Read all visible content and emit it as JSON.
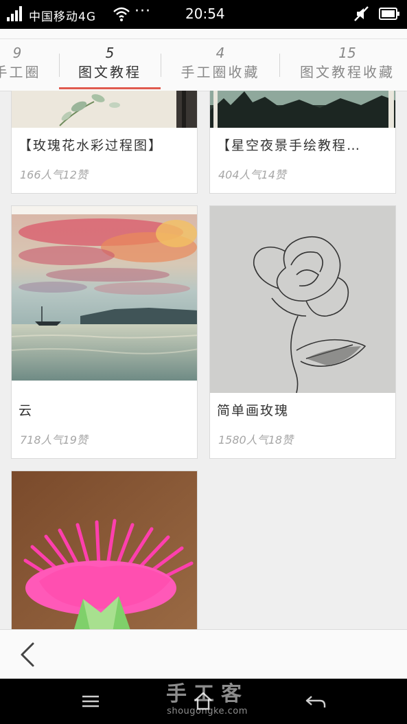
{
  "status_bar": {
    "carrier": "中国移动4G",
    "dots": "···",
    "time": "20:54",
    "icons": [
      "signal-icon",
      "wifi-icon",
      "mute-icon",
      "battery-icon"
    ]
  },
  "tabs": [
    {
      "count": "9",
      "label": "手工圈"
    },
    {
      "count": "5",
      "label": "图文教程",
      "active": true
    },
    {
      "count": "4",
      "label": "手工圈收藏"
    },
    {
      "count": "15",
      "label": "图文教程收藏"
    }
  ],
  "cards": [
    {
      "title": "【玫瑰花水彩过程图】",
      "stats": "166人气12赞"
    },
    {
      "title": "【星空夜景手绘教程…",
      "stats": "404人气14赞"
    },
    {
      "title": "云",
      "stats": "718人气19赞"
    },
    {
      "title": "简单画玫瑰",
      "stats": "1580人气18赞"
    },
    {
      "title": "",
      "stats": ""
    }
  ],
  "watermark": {
    "logo": "手工客",
    "url": "shougongke.com"
  },
  "colors": {
    "accent": "#e05a4e",
    "background": "#efefef",
    "status_bar": "#000000"
  }
}
